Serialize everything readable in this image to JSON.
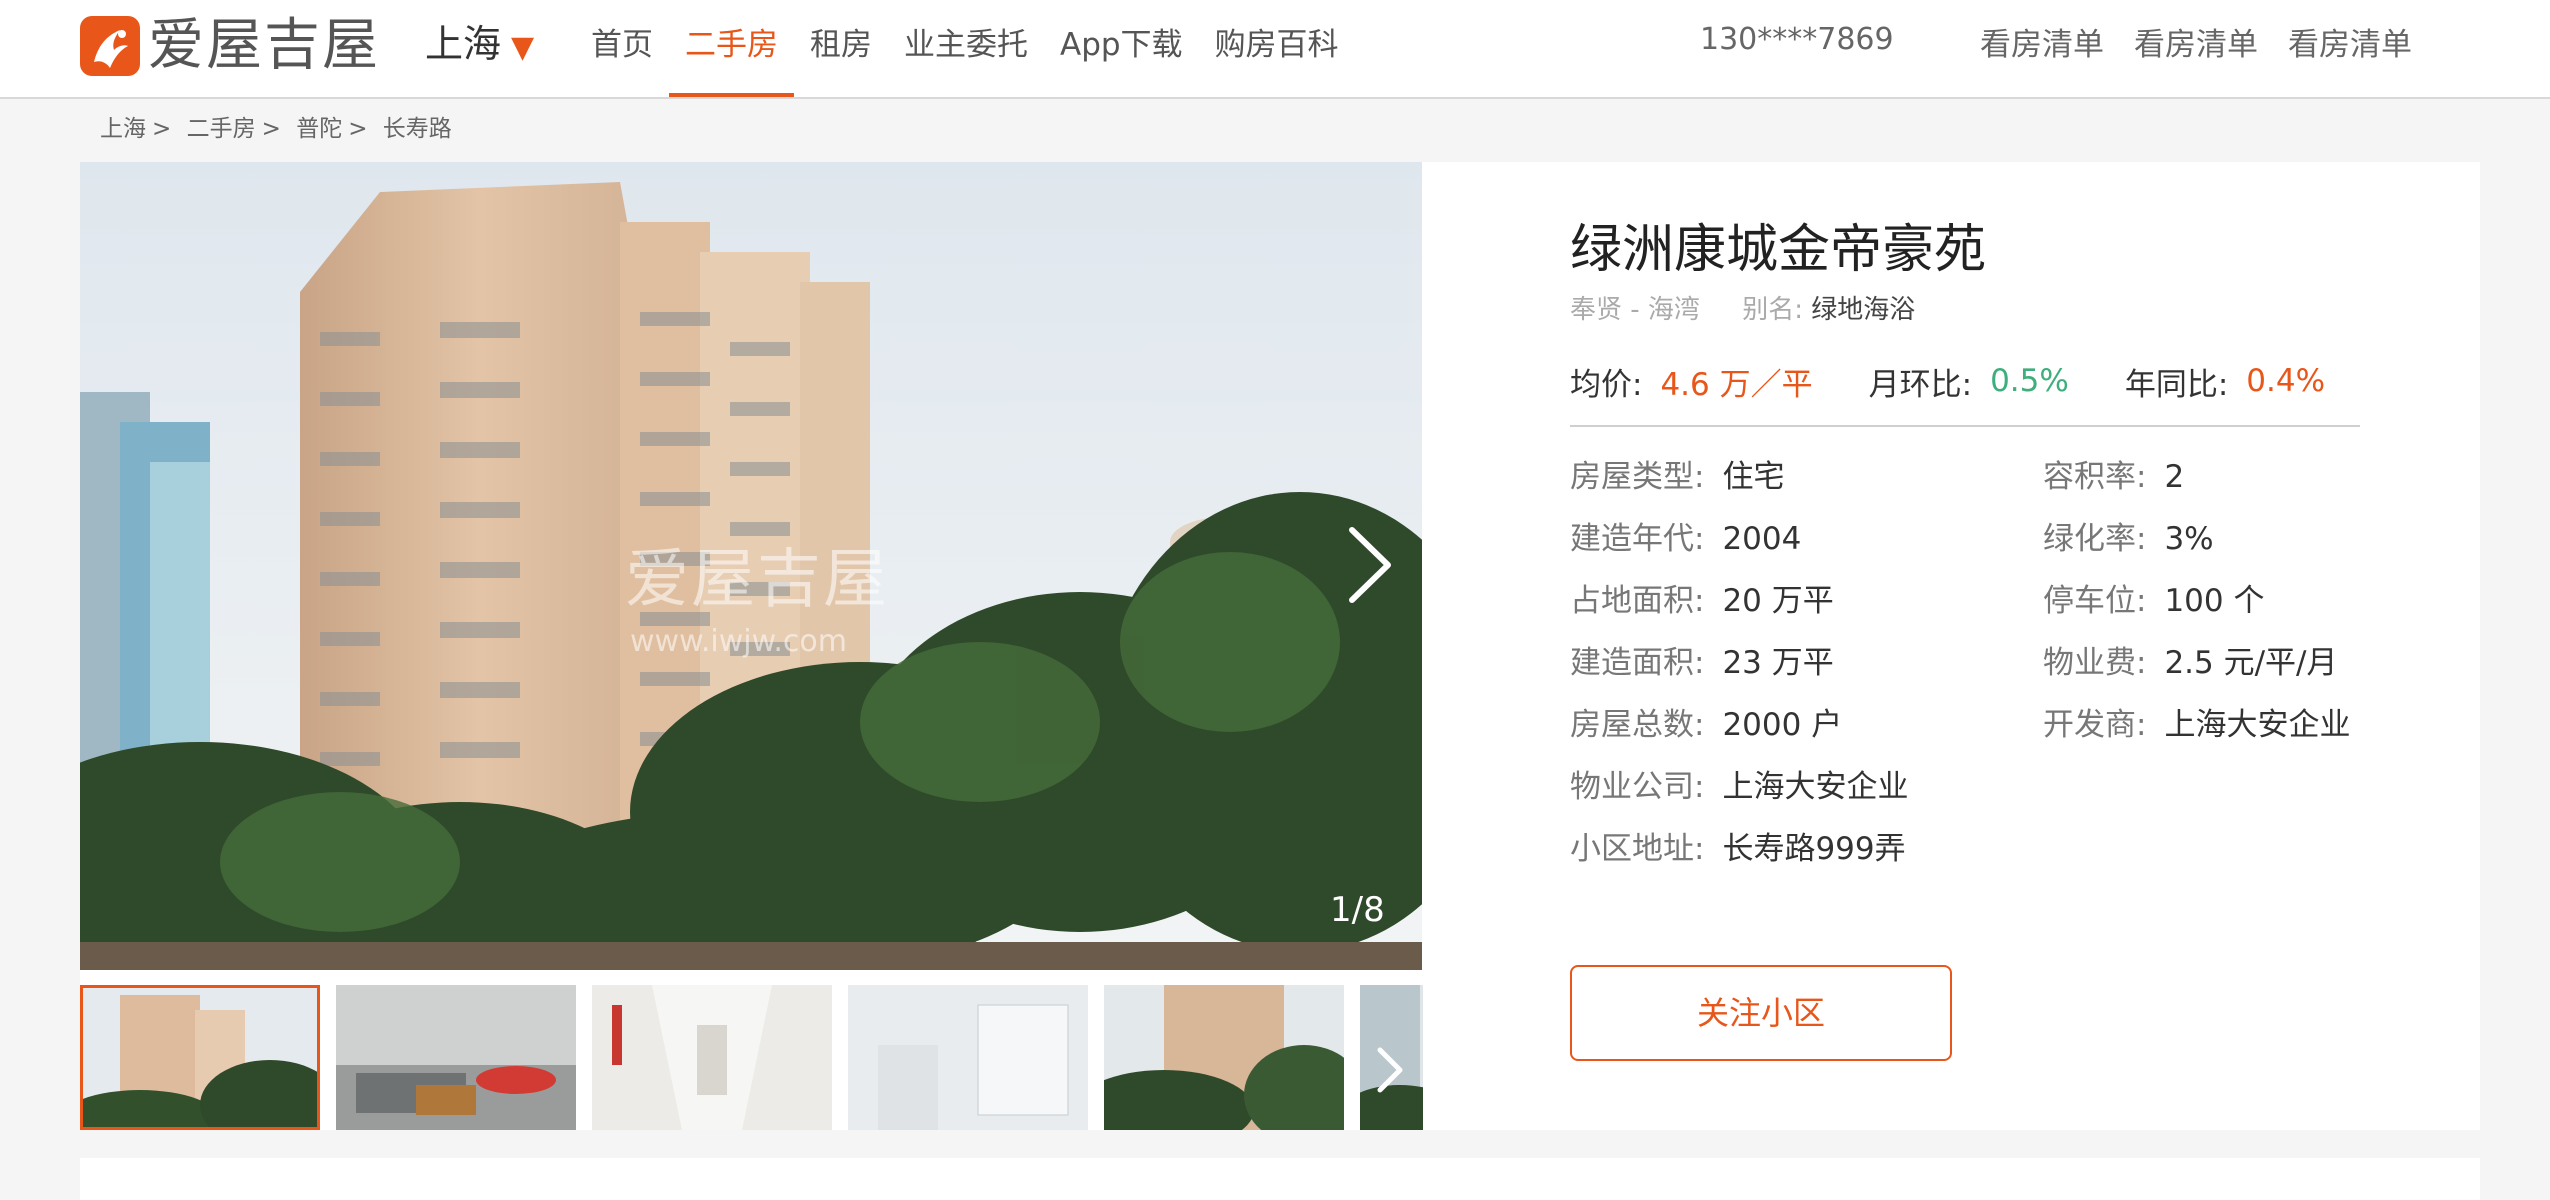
{
  "header": {
    "brand": "爱屋吉屋",
    "city": "上海",
    "nav": [
      "首页",
      "二手房",
      "租房",
      "业主委托",
      "App下载",
      "购房百科"
    ],
    "active_nav": "二手房",
    "phone": "130****7869",
    "right_links": [
      "看房清单",
      "看房清单",
      "看房清单"
    ]
  },
  "breadcrumb": [
    "上海",
    "二手房",
    "普陀",
    "长寿路"
  ],
  "gallery": {
    "counter": "1/8",
    "watermark": "爱屋吉屋",
    "watermark_url": "www.iwjw.com",
    "thumbnails": [
      "exterior-tower",
      "kitchen",
      "hallway",
      "bathroom",
      "exterior-trees",
      "exterior-partial"
    ]
  },
  "community": {
    "name": "绿洲康城金帝豪苑",
    "district": "奉贤 - 海湾",
    "alias_label": "别名:",
    "alias": "绿地海浴",
    "avg_price_label": "均价:",
    "avg_price": "4.6 万／平",
    "mom_label": "月环比:",
    "mom": "0.5%",
    "yoy_label": "年同比:",
    "yoy": "0.4%",
    "attributes_left": [
      {
        "label": "房屋类型:",
        "value": "住宅"
      },
      {
        "label": "建造年代:",
        "value": "2004"
      },
      {
        "label": "占地面积:",
        "value": "20 万平"
      },
      {
        "label": "建造面积:",
        "value": "23 万平"
      },
      {
        "label": "房屋总数:",
        "value": "2000 户"
      },
      {
        "label": "物业公司:",
        "value": "上海大安企业"
      },
      {
        "label": "小区地址:",
        "value": "长寿路999弄"
      }
    ],
    "attributes_right": [
      {
        "label": "容积率:",
        "value": "2"
      },
      {
        "label": "绿化率:",
        "value": "3%"
      },
      {
        "label": "停车位:",
        "value": "100 个"
      },
      {
        "label": "物业费:",
        "value": "2.5 元/平/月"
      },
      {
        "label": "开发商:",
        "value": "上海大安企业"
      }
    ],
    "follow_button": "关注小区"
  },
  "colors": {
    "accent": "#e8561a",
    "positive": "#3eaf7c"
  }
}
